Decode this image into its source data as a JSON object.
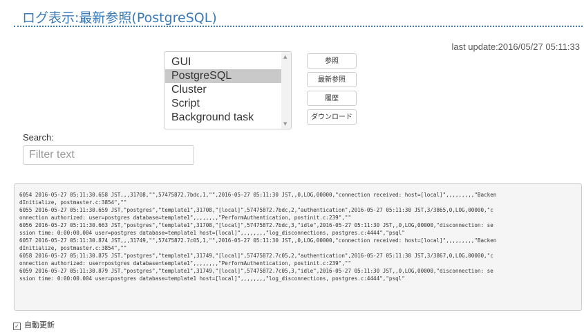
{
  "title": "ログ表示:最新参照(PostgreSQL)",
  "last_update": "last update:2016/05/27 05:11:33",
  "log_types": [
    "GUI",
    "PostgreSQL",
    "Cluster",
    "Script",
    "Background task"
  ],
  "selected_log_type": "PostgreSQL",
  "buttons": {
    "view": "参照",
    "latest": "最新参照",
    "history": "履歴",
    "download": "ダウンロード"
  },
  "search": {
    "label": "Search:",
    "placeholder": "Filter text",
    "value": ""
  },
  "log_lines": [
    "6054 2016-05-27 05:11:30.658 JST,,,31708,\"\",57475872.7bdc,1,\"\",2016-05-27 05:11:30 JST,,0,LOG,00000,\"connection received: host=[local]\",,,,,,,,,\"Backen",
    "dInitialize, postmaster.c:3854\",\"\"",
    "6055 2016-05-27 05:11:30.659 JST,\"postgres\",\"template1\",31708,\"[local]\",57475872.7bdc,2,\"authentication\",2016-05-27 05:11:30 JST,3/3865,0,LOG,00000,\"c",
    "onnection authorized: user=postgres database=template1\",,,,,,,,\"PerformAuthentication, postinit.c:239\",\"\"",
    "6056 2016-05-27 05:11:30.663 JST,\"postgres\",\"template1\",31708,\"[local]\",57475872.7bdc,3,\"idle\",2016-05-27 05:11:30 JST,,0,LOG,00000,\"disconnection: se",
    "ssion time: 0:00:00.004 user=postgres database=template1 host=[local]\",,,,,,,,\"log_disconnections, postgres.c:4444\",\"psql\"",
    "6057 2016-05-27 05:11:30.874 JST,,,31749,\"\",57475872.7c05,1,\"\",2016-05-27 05:11:30 JST,,0,LOG,00000,\"connection received: host=[local]\",,,,,,,,,\"Backen",
    "dInitialize, postmaster.c:3854\",\"\"",
    "6058 2016-05-27 05:11:30.875 JST,\"postgres\",\"template1\",31749,\"[local]\",57475872.7c05,2,\"authentication\",2016-05-27 05:11:30 JST,3/3867,0,LOG,00000,\"c",
    "onnection authorized: user=postgres database=template1\",,,,,,,,\"PerformAuthentication, postinit.c:239\",\"\"",
    "6059 2016-05-27 05:11:30.879 JST,\"postgres\",\"template1\",31749,\"[local]\",57475872.7c05,3,\"idle\",2016-05-27 05:11:30 JST,,0,LOG,00000,\"disconnection: se",
    "ssion time: 0:00:00.004 user=postgres database=template1 host=[local]\",,,,,,,,\"log_disconnections, postgres.c:4444\",\"psql\""
  ],
  "auto_update": {
    "label": "自動更新",
    "checked": true
  },
  "colors": {
    "title": "#3a7ab7",
    "selected_item": "#c9c9c9",
    "log_background": "#f5f5f5"
  }
}
